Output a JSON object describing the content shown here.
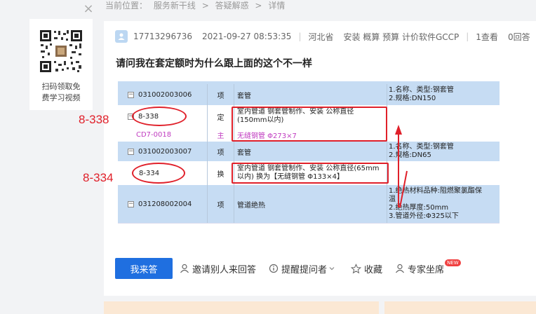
{
  "breadcrumb": [
    "当前位置：",
    "服务新干线",
    ">",
    "答疑解惑",
    ">",
    "详情"
  ],
  "qr": {
    "caption_line1": "扫码领取免",
    "caption_line2": "费学习视频"
  },
  "question": {
    "user": "17713296736",
    "time": "2021-09-27 08:53:35",
    "region": "河北省",
    "tags": "安装 概算 预算 计价软件GCCP",
    "views": "1查看",
    "answers": "0回答",
    "title": "请问我在套定额时为什么跟上面的这个不一样"
  },
  "screenshot": {
    "rows": [
      {
        "code": "031002003006",
        "type": "项",
        "name": "套管",
        "feature": [
          "1.名称、类型:钢套管",
          "2.规格:DN150"
        ]
      },
      {
        "code": "8-338",
        "type": "定",
        "name": [
          "室内管道 钢套管制作、安装 公称直径",
          "(150mm以内)"
        ],
        "feature": []
      },
      {
        "code": "CD7-0018",
        "type": "主",
        "name": "无缝钢管 Φ273×7",
        "feature": []
      },
      {
        "code": "031002003007",
        "type": "项",
        "name": "套管",
        "feature": [
          "1.名称、类型:钢套管",
          "2.规格:DN65"
        ]
      },
      {
        "code": "8-334",
        "type": "换",
        "name": [
          "室内管道 钢套管制作、安装 公称直径(65mm",
          "以内)  换为【无缝钢管 Φ133×4】"
        ],
        "feature": []
      },
      {
        "code": "031208002004",
        "type": "项",
        "name": "管道绝热",
        "feature": [
          "1.绝热材料品种:阻燃聚氯酯保",
          "温",
          "2.绝热厚度:50mm",
          "3.管道外径:Φ325以下"
        ]
      }
    ],
    "annotation_1": "8-338",
    "annotation_2": "8-334"
  },
  "actions": {
    "answer": "我来答",
    "invite": "邀请别人来回答",
    "remind": "提醒提问者",
    "favorite": "收藏",
    "expert": "专家坐席",
    "new_badge": "NEW"
  }
}
